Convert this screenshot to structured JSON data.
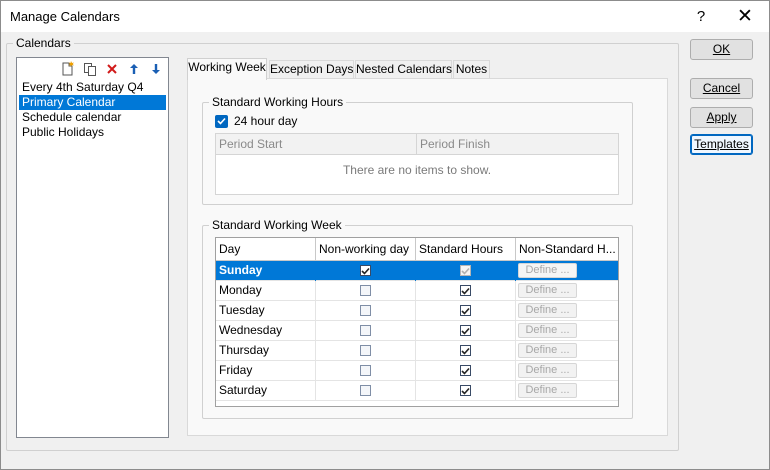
{
  "window": {
    "title": "Manage Calendars",
    "help_label": "?",
    "close_label": "✕"
  },
  "calendars": {
    "label": "Calendars",
    "toolbar": {
      "new_icon": "new-document-icon",
      "copy_icon": "copy-icon",
      "delete_icon": "delete-icon",
      "up_icon": "arrow-up-icon",
      "down_icon": "arrow-down-icon"
    },
    "items": [
      {
        "label": "Every 4th Saturday Q4",
        "selected": false
      },
      {
        "label": "Primary Calendar",
        "selected": true
      },
      {
        "label": "Schedule calendar",
        "selected": false
      },
      {
        "label": "Public Holidays",
        "selected": false
      }
    ]
  },
  "tabs": [
    {
      "label": "Working Week",
      "active": true
    },
    {
      "label": "Exception Days",
      "active": false
    },
    {
      "label": "Nested Calendars",
      "active": false
    },
    {
      "label": "Notes",
      "active": false
    }
  ],
  "standard_hours": {
    "label": "Standard Working Hours",
    "all_day_label": "24 hour day",
    "all_day_checked": true,
    "columns": [
      "Period Start",
      "Period Finish"
    ],
    "empty_message": "There are no items to show."
  },
  "standard_week": {
    "label": "Standard Working Week",
    "columns": [
      "Day",
      "Non-working day",
      "Standard Hours",
      "Non-Standard H..."
    ],
    "define_label": "Define ...",
    "rows": [
      {
        "day": "Sunday",
        "non_working": true,
        "standard": true,
        "selected": true
      },
      {
        "day": "Monday",
        "non_working": false,
        "standard": true,
        "selected": false
      },
      {
        "day": "Tuesday",
        "non_working": false,
        "standard": true,
        "selected": false
      },
      {
        "day": "Wednesday",
        "non_working": false,
        "standard": true,
        "selected": false
      },
      {
        "day": "Thursday",
        "non_working": false,
        "standard": true,
        "selected": false
      },
      {
        "day": "Friday",
        "non_working": false,
        "standard": true,
        "selected": false
      },
      {
        "day": "Saturday",
        "non_working": false,
        "standard": true,
        "selected": false
      }
    ]
  },
  "buttons": {
    "ok": "OK",
    "cancel": "Cancel",
    "apply": "Apply",
    "templates": "Templates"
  },
  "colors": {
    "accent": "#0078d7",
    "checkbox": "#0067c0",
    "delete": "#d11a1a"
  }
}
